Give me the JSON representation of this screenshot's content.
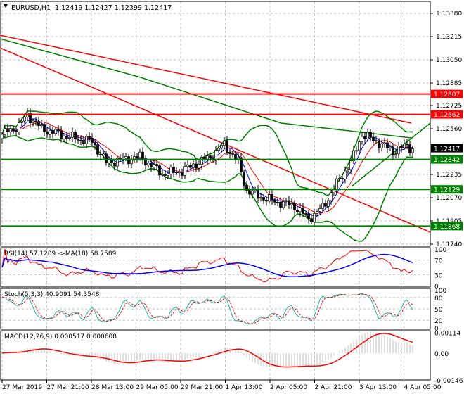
{
  "chart_data": {
    "type": "candlestick",
    "title": "EURUSD,H1",
    "ohlc_header": [
      "1.12419",
      "1.12427",
      "1.12399",
      "1.12417"
    ],
    "price_ticks": [
      "1.13380",
      "1.13215",
      "1.13050",
      "1.12885",
      "1.12725",
      "1.12560",
      "1.12235",
      "1.12070",
      "1.11905",
      "1.11740"
    ],
    "ylim": [
      1.1173,
      1.1347
    ],
    "levels": [
      {
        "label": "1.12807",
        "value": 1.12807,
        "color": "#ff0000"
      },
      {
        "label": "1.12662",
        "value": 1.12662,
        "color": "#ff0000"
      },
      {
        "label": "1.12342",
        "value": 1.12342,
        "color": "#008000"
      },
      {
        "label": "1.12129",
        "value": 1.12129,
        "color": "#008000"
      },
      {
        "label": "1.11868",
        "value": 1.11868,
        "color": "#008000"
      }
    ],
    "current_price": {
      "label": "1.12417",
      "value": 1.12417
    },
    "close_anchors": [
      [
        0,
        1.1252
      ],
      [
        6,
        1.1258
      ],
      [
        9,
        1.1266
      ],
      [
        14,
        1.1256
      ],
      [
        24,
        1.125
      ],
      [
        32,
        1.1247
      ],
      [
        37,
        1.1232
      ],
      [
        49,
        1.1236
      ],
      [
        57,
        1.1224
      ],
      [
        64,
        1.1226
      ],
      [
        74,
        1.1236
      ],
      [
        79,
        1.1245
      ],
      [
        84,
        1.1232
      ],
      [
        87,
        1.1212
      ],
      [
        94,
        1.1206
      ],
      [
        104,
        1.1201
      ],
      [
        109,
        1.1192
      ],
      [
        114,
        1.12
      ],
      [
        119,
        1.1217
      ],
      [
        124,
        1.1232
      ],
      [
        128,
        1.1252
      ],
      [
        134,
        1.1246
      ],
      [
        139,
        1.124
      ],
      [
        144,
        1.1244
      ],
      [
        146,
        1.12417
      ]
    ],
    "time_labels": [
      "27 Mar 2019",
      "27 Mar 21:00",
      "28 Mar 13:00",
      "29 Mar 05:00",
      "29 Mar 21:00",
      "1 Apr 13:00",
      "2 Apr 05:00",
      "2 Apr 21:00",
      "3 Apr 13:00",
      "4 Apr 05:00"
    ],
    "rsi": {
      "title": "RSI(14) 57.1209  ->MA(18) 58.7589",
      "ticks": [
        "100",
        "70",
        "30",
        "0"
      ]
    },
    "stoch": {
      "title": "Stoch(5,3,3) 40.9091 54.3548",
      "ticks": [
        "100",
        "80",
        "50",
        "20",
        "0"
      ]
    },
    "macd": {
      "title": "MACD(12,26,9) 0.000517 0.000608",
      "ticks": [
        "0.00114",
        "0.00",
        "-0.00146"
      ]
    },
    "colors": {
      "bull": "#ffffff",
      "bear": "#000000",
      "band": "#008000",
      "trend": "#ff0000",
      "rsi": "#ff0000",
      "rsi_ma": "#0000ff",
      "stoch_main": "#20b2aa",
      "stoch_signal": "#ff0000",
      "macd_signal": "#ff0000",
      "macd_hist": "#c0c0c0"
    }
  }
}
